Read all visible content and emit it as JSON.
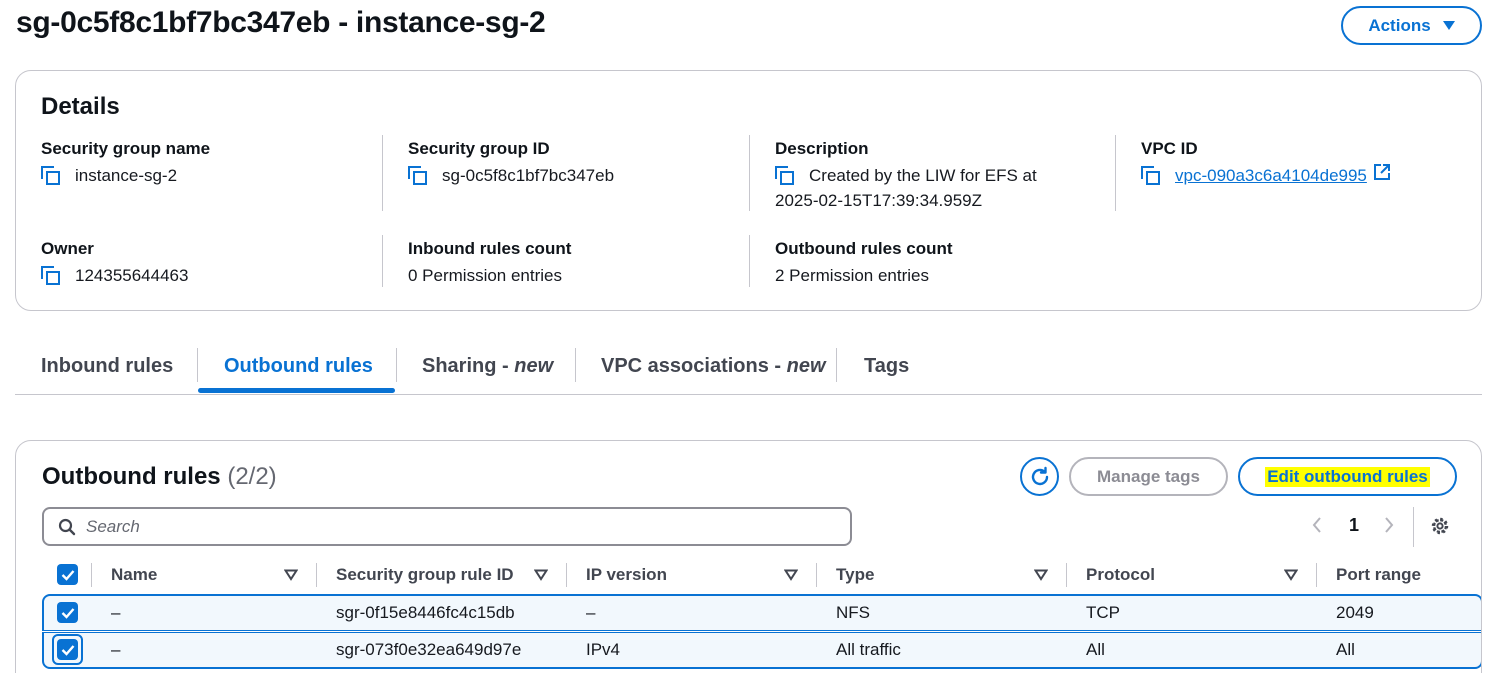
{
  "header": {
    "title": "sg-0c5f8c1bf7bc347eb - instance-sg-2",
    "actions_label": "Actions"
  },
  "details": {
    "title": "Details",
    "security_group_name": {
      "label": "Security group name",
      "value": "instance-sg-2"
    },
    "security_group_id": {
      "label": "Security group ID",
      "value": "sg-0c5f8c1bf7bc347eb"
    },
    "description": {
      "label": "Description",
      "value_line1": "Created by the LIW for EFS at",
      "value_line2": "2025-02-15T17:39:34.959Z"
    },
    "vpc_id": {
      "label": "VPC ID",
      "value": "vpc-090a3c6a4104de995"
    },
    "owner": {
      "label": "Owner",
      "value": "124355644463"
    },
    "inbound_rules_count": {
      "label": "Inbound rules count",
      "value": "0 Permission entries"
    },
    "outbound_rules_count": {
      "label": "Outbound rules count",
      "value": "2 Permission entries"
    }
  },
  "tabs": [
    {
      "label": "Inbound rules",
      "suffix": ""
    },
    {
      "label": "Outbound rules",
      "suffix": ""
    },
    {
      "label": "Sharing - ",
      "suffix": "new"
    },
    {
      "label": "VPC associations - ",
      "suffix": "new"
    },
    {
      "label": "Tags",
      "suffix": ""
    }
  ],
  "active_tab": "Outbound rules",
  "outbound": {
    "title": "Outbound rules",
    "count": "(2/2)",
    "manage_tags_label": "Manage tags",
    "edit_label": "Edit outbound rules",
    "search_placeholder": "Search",
    "page": "1",
    "columns": [
      "Name",
      "Security group rule ID",
      "IP version",
      "Type",
      "Protocol",
      "Port range"
    ],
    "rows": [
      {
        "name": "–",
        "rule_id": "sgr-0f15e8446fc4c15db",
        "ip_version": "–",
        "type": "NFS",
        "protocol": "TCP",
        "port_range": "2049",
        "selected": true
      },
      {
        "name": "–",
        "rule_id": "sgr-073f0e32ea649d97e",
        "ip_version": "IPv4",
        "type": "All traffic",
        "protocol": "All",
        "port_range": "All",
        "selected": true
      }
    ]
  },
  "colors": {
    "accent": "#0972d3",
    "selected_row_bg": "#f2f8fd",
    "highlight": "#ffff00",
    "border": "#c6c6cd"
  }
}
